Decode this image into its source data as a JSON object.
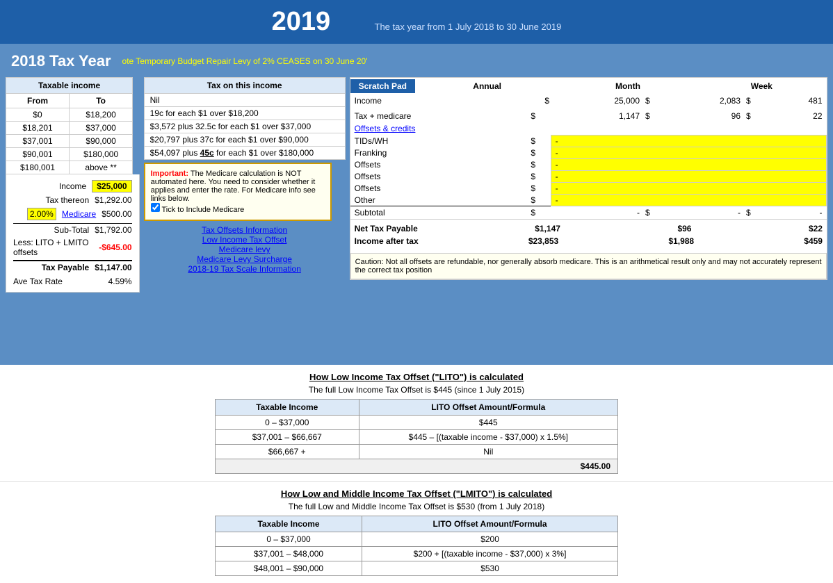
{
  "header": {
    "year": "2019",
    "subtitle": "The tax year from 1 July 2018 to 30 June 2019"
  },
  "taxYearPanel": {
    "title": "2018 Tax Year",
    "budgetNote": "ote Temporary Budget Repair Levy of 2% CEASES on 30 June 20'"
  },
  "taxableIncomeTable": {
    "header": "Taxable income",
    "col1": "From",
    "col2": "To",
    "rows": [
      {
        "from": "$0",
        "to": "$18,200"
      },
      {
        "from": "$18,201",
        "to": "$37,000"
      },
      {
        "from": "$37,001",
        "to": "$90,000"
      },
      {
        "from": "$90,001",
        "to": "$180,000"
      },
      {
        "from": "$180,001",
        "to": "above **"
      }
    ]
  },
  "taxOnIncomeTable": {
    "header": "Tax on this income",
    "rows": [
      "Nil",
      "19c for each $1 over $18,200",
      "$3,572 plus 32.5c for each $1 over $37,000",
      "$20,797 plus 37c for each $1 over $90,000",
      "$54,097 plus 45c for each $1 over $180,000"
    ]
  },
  "calculation": {
    "incomeLabel": "Income",
    "incomeValue": "$25,000",
    "taxThereonLabel": "Tax thereon",
    "taxThereonValue": "$1,292.00",
    "medicarePercent": "2.00%",
    "medicareLabel": "Medicare",
    "medicareValue": "$500.00",
    "subTotalLabel": "Sub-Total",
    "subTotalValue": "$1,792.00",
    "litoLabel": "Less: LITO + LMITO offsets",
    "litoValue": "-$645.00",
    "taxPayableLabel": "Tax Payable",
    "taxPayableValue": "$1,147.00",
    "aveTaxRateLabel": "Ave Tax Rate",
    "aveTaxRateValue": "4.59%"
  },
  "tooltip": {
    "important": "Important:",
    "text": "The Medicare calculation is NOT automated here. You need to consider whether it applies and enter the rate. For Medicare info see links below.",
    "checkbox": "Tick to Include Medicare"
  },
  "links": {
    "taxOffsets": "Tax Offsets Information",
    "lowIncome": "Low Income Tax Offset",
    "medicareLevy": "Medicare levy",
    "medicareSurcharge": "Medicare Levy Surcharge",
    "taxScale": "2018-19 Tax Scale Information"
  },
  "scratchPad": {
    "title": "Scratch Pad",
    "colAnnual": "Annual",
    "colMonth": "Month",
    "colWeek": "Week",
    "incomeLabel": "Income",
    "incomeDollar": "$",
    "incomeAnnual": "25,000",
    "incomeMonthDollar": "$",
    "incomeMonth": "2,083",
    "incomeWeekDollar": "$",
    "incomeWeek": "481",
    "taxMedicareLabel": "Tax + medicare",
    "taxMedicareDollar": "$",
    "taxMedicareAnnual": "1,147",
    "taxMedicareMonthDollar": "$",
    "taxMedicareMonth": "96",
    "taxMedicareWeekDollar": "$",
    "taxMedicareWeek": "22",
    "offsetsCreditsLabel": "Offsets & credits",
    "rows": [
      {
        "label": "TIDs/WH",
        "dollar": "$",
        "value": "-"
      },
      {
        "label": "Franking",
        "dollar": "$",
        "value": "-"
      },
      {
        "label": "Offsets",
        "dollar": "$",
        "value": "-"
      },
      {
        "label": "Offsets",
        "dollar": "$",
        "value": "-"
      },
      {
        "label": "Offsets",
        "dollar": "$",
        "value": "-"
      },
      {
        "label": "Other",
        "dollar": "$",
        "value": "-"
      }
    ],
    "subtotalLabel": "Subtotal",
    "subtotalDollar": "$",
    "subtotalAnnual": "-",
    "subtotalMonthDollar": "$",
    "subtotalMonth": "-",
    "subtotalWeekDollar": "$",
    "subtotalWeek": "-",
    "netTaxLabel": "Net Tax Payable",
    "netTaxAnnual": "$1,147",
    "netTaxMonth": "$96",
    "netTaxWeek": "$22",
    "incomeAfterLabel": "Income after tax",
    "incomeAfterAnnual": "$23,853",
    "incomeAfterMonth": "$1,988",
    "incomeAfterWeek": "$459",
    "caution": "Caution: Not all offsets are refundable, nor generally absorb medicare. This is an arithmetical result only and may not accurately represent the correct tax position"
  },
  "litoSection": {
    "title": "How Low Income Tax Offset (\"LITO\") is calculated",
    "subtitle": "The full Low Income Tax Offset is $445 (since 1 July 2015)",
    "col1": "Taxable Income",
    "col2": "LITO Offset Amount/Formula",
    "rows": [
      {
        "income": "0 – $37,000",
        "formula": "$445"
      },
      {
        "income": "$37,001 – $66,667",
        "formula": "$445 – [(taxable income - $37,000) x 1.5%]"
      },
      {
        "income": "$66,667 +",
        "formula": "Nil"
      }
    ],
    "totalLabel": "$445.00"
  },
  "lmitoSection": {
    "title": "How Low and Middle Income Tax Offset (\"LMITO\") is calculated",
    "subtitle": "The full Low and Middle Income Tax Offset is $530 (from 1 July 2018)",
    "col1": "Taxable Income",
    "col2": "LITO Offset Amount/Formula",
    "rows": [
      {
        "income": "0 – $37,000",
        "formula": "$200"
      },
      {
        "income": "$37,001 – $48,000",
        "formula": "$200 + [(taxable income - $37,000) x 3%]"
      },
      {
        "income": "$48,001 – $90,000",
        "formula": "$530"
      }
    ]
  }
}
